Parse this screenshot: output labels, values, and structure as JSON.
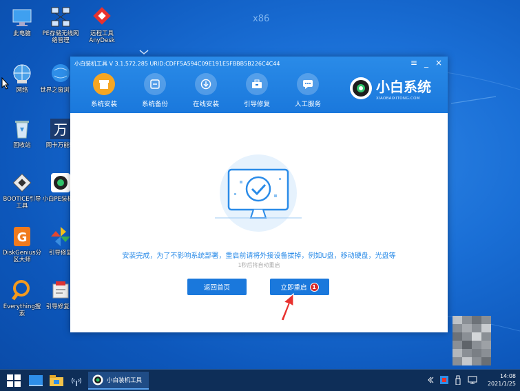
{
  "desktop": {
    "watermark": "x86",
    "icons": [
      {
        "label": "此电脑"
      },
      {
        "label": "PE存储无线网络管理"
      },
      {
        "label": "远程工具AnyDesk"
      },
      {
        "label": "网络"
      },
      {
        "label": "世界之窗浏览器"
      },
      {
        "label": "回收站"
      },
      {
        "label": "网卡万能驱"
      },
      {
        "label": "BOOTICE引导工具"
      },
      {
        "label": "小白PE装机具"
      },
      {
        "label": "DiskGenius分区大师"
      },
      {
        "label": "引导修复"
      },
      {
        "label": "Everything搜索"
      },
      {
        "label": "引导修复工"
      }
    ]
  },
  "window": {
    "title": "小白装机工具 V 3.1.572.285 URID:CDFF5A594C09E191E5FBBB5B226C4C44",
    "controls": {
      "menu": "≡",
      "minimize": "_",
      "close": "×"
    },
    "tabs": [
      {
        "label": "系统安装",
        "active": true,
        "icon": "box-icon"
      },
      {
        "label": "系统备份",
        "active": false,
        "icon": "backup-icon"
      },
      {
        "label": "在线安装",
        "active": false,
        "icon": "download-icon"
      },
      {
        "label": "引导修复",
        "active": false,
        "icon": "toolbox-icon"
      },
      {
        "label": "人工服务",
        "active": false,
        "icon": "chat-icon"
      }
    ],
    "brand": {
      "name": "小白系统",
      "sub": "XIAOBAIXITONG.COM"
    },
    "message": "安装完成，为了不影响系统部署，重启前请将外接设备拔掉，例如U盘，移动硬盘，光盘等",
    "countdown": "1秒后将自动重启",
    "buttons": {
      "home": "返回首页",
      "restart": "立即重启",
      "badge": "1"
    }
  },
  "taskbar": {
    "app_label": "小白装机工具",
    "time": "14:08",
    "date": "2021/1/25",
    "colors": {
      "bar": "#0e2e58",
      "accent": "#1a78dc"
    }
  }
}
